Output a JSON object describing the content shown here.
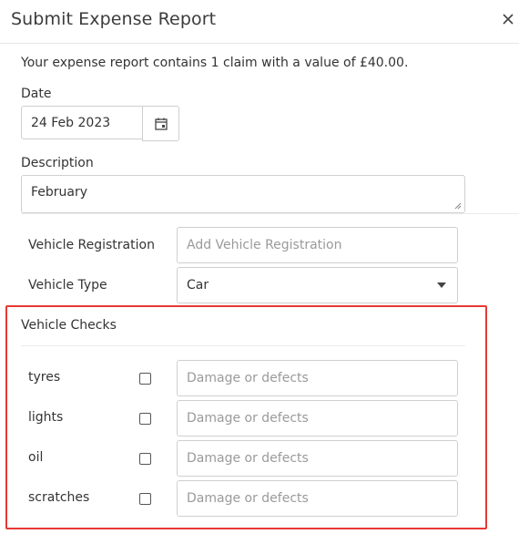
{
  "dialog": {
    "title": "Submit Expense Report",
    "summary": "Your expense report contains 1 claim with a value of £40.00."
  },
  "date": {
    "label": "Date",
    "value": "24 Feb 2023"
  },
  "description": {
    "label": "Description",
    "value": "February"
  },
  "vehicle_registration": {
    "label": "Vehicle Registration",
    "placeholder": "Add Vehicle Registration"
  },
  "vehicle_type": {
    "label": "Vehicle Type",
    "selected": "Car"
  },
  "vehicle_checks": {
    "title": "Vehicle Checks",
    "items": [
      {
        "label": "tyres",
        "placeholder": "Damage or defects",
        "checked": false
      },
      {
        "label": "lights",
        "placeholder": "Damage or defects",
        "checked": false
      },
      {
        "label": "oil",
        "placeholder": "Damage or defects",
        "checked": false
      },
      {
        "label": "scratches",
        "placeholder": "Damage or defects",
        "checked": false
      }
    ]
  },
  "colors": {
    "highlight": "#e53935",
    "border": "#cfcfcf",
    "placeholder": "#9a9a9a"
  }
}
